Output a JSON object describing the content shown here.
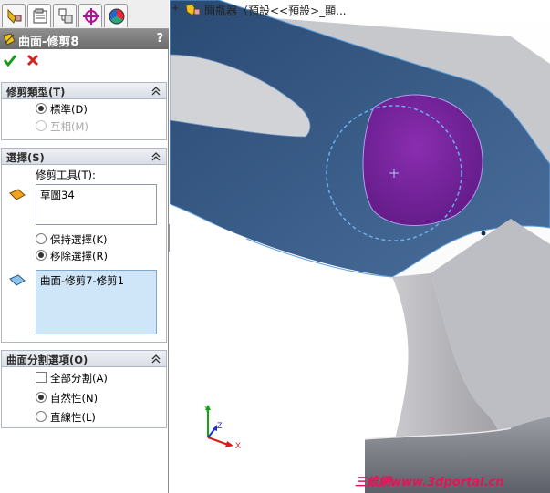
{
  "feature_tree": {
    "expand": "+",
    "text": "開瓶器（預設<<預設>_顯..."
  },
  "panel": {
    "title": "曲面-修剪8",
    "help": "?",
    "tabs": [
      "feature-manager",
      "property-manager",
      "configuration-manager",
      "dimxpert-manager",
      "display-manager"
    ]
  },
  "trim_type": {
    "header": "修剪類型(T)",
    "options": [
      {
        "label": "標準(D)",
        "selected": true,
        "enabled": true
      },
      {
        "label": "互相(M)",
        "selected": false,
        "enabled": false
      }
    ]
  },
  "selections": {
    "header": "選擇(S)",
    "trim_tool_label": "修剪工具(T):",
    "trim_tool_value": "草圖34",
    "options": [
      {
        "label": "保持選擇(K)",
        "selected": false
      },
      {
        "label": "移除選擇(R)",
        "selected": true
      }
    ],
    "pieces_value": "曲面-修剪7-修剪1"
  },
  "split_options": {
    "header": "曲面分割選項(O)",
    "split_all": {
      "label": "全部分割(A)",
      "checked": false
    },
    "options": [
      {
        "label": "自然性(N)",
        "selected": true
      },
      {
        "label": "直線性(L)",
        "selected": false
      }
    ]
  },
  "triad": {
    "x": "X",
    "y": "Y",
    "z": "Z"
  },
  "watermark": "三維網www.3dportal.cn",
  "colors": {
    "accept": "#1a9a1a",
    "cancel": "#d42222",
    "selection": "#cfe5f8",
    "surface": "#3d5d88",
    "highlight": "#7a259b"
  }
}
